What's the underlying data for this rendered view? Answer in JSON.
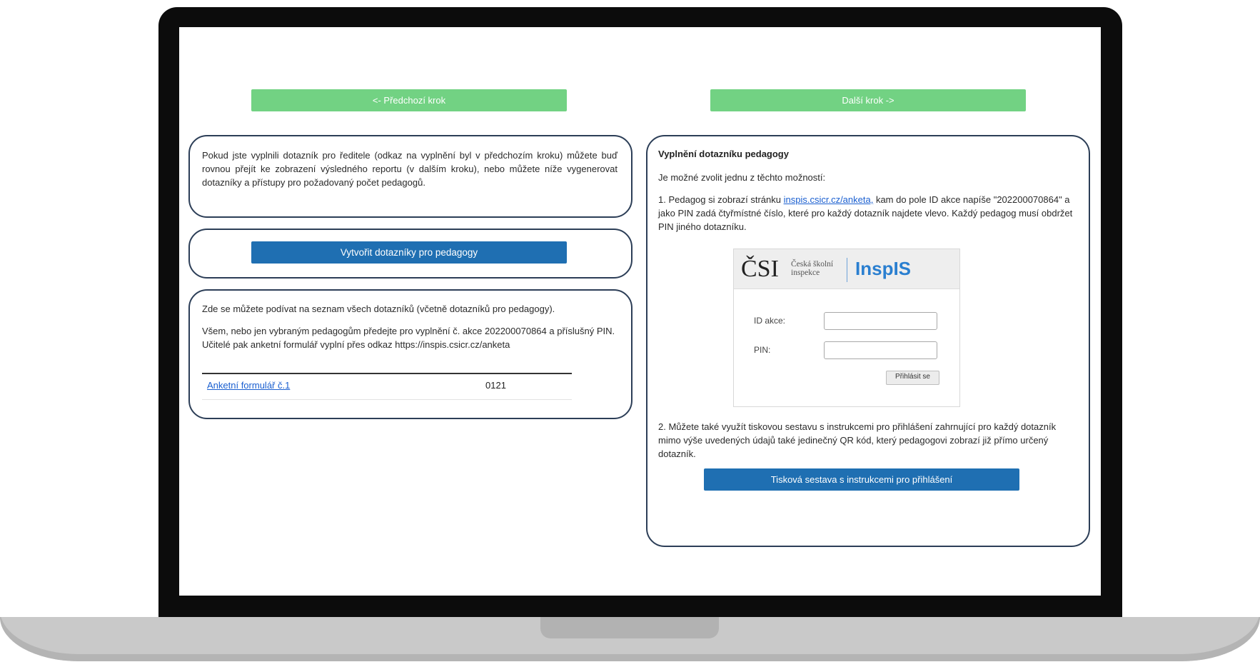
{
  "nav": {
    "prev_label": "<- Předchozí krok",
    "next_label": "Další krok ->"
  },
  "intro": {
    "text": "Pokud jste vyplnili dotazník pro ředitele (odkaz na vyplnění byl v předchozím kroku) můžete buď rovnou přejít ke zobrazení výsledného reportu (v dalším kroku), nebo můžete níže vygenerovat dotazníky a přístupy pro požadovaný počet pedagogů."
  },
  "create": {
    "button_label": "Vytvořit dotazníky pro pedagogy"
  },
  "list": {
    "line1": "Zde se můžete podívat na seznam všech dotazníků (včetně dotazníků pro pedagogy).",
    "line2": "Všem, nebo jen vybraným pedagogům předejte pro vyplnění č. akce 202200070864 a příslušný PIN. Učitelé pak anketní formulář vyplní přes odkaz https://inspis.csicr.cz/anketa",
    "rows": [
      {
        "link": "Anketní formulář č.1",
        "pin": "0121"
      }
    ]
  },
  "right": {
    "heading": "Vyplnění dotazníku pedagogy",
    "subtitle": "Je možné zvolit jednu z těchto možností:",
    "option1_pre": "1. Pedagog si zobrazí stránku ",
    "option1_link": "inspis.csicr.cz/anketa,",
    "option1_post": " kam do pole ID akce napíše \"202200070864\" a jako PIN zadá čtyřmístné číslo, které pro každý dotazník najdete vlevo. Každý pedagog musí obdržet PIN jiného dotazníku.",
    "option2": "2. Můžete také využít tiskovou sestavu s instrukcemi pro přihlášení zahrnující pro každý dotazník mimo výše uvedených údajů také jedinečný QR kód, který pedagogovi zobrazí již přímo určený dotazník.",
    "print_button": "Tisková sestava s instrukcemi pro přihlášení"
  },
  "login_mock": {
    "logo_csi": "ČSI",
    "logo_sub_line1": "Česká školní",
    "logo_sub_line2": "inspekce",
    "logo_inspis": "InspIS",
    "id_label": "ID akce:",
    "pin_label": "PIN:",
    "login_button": "Přihlásit se"
  },
  "colors": {
    "nav_button": "#72d283",
    "primary_button": "#1f6fb2",
    "panel_border": "#2c3e57",
    "link": "#1a5fd0",
    "inspis_brand": "#2a7fd0"
  }
}
